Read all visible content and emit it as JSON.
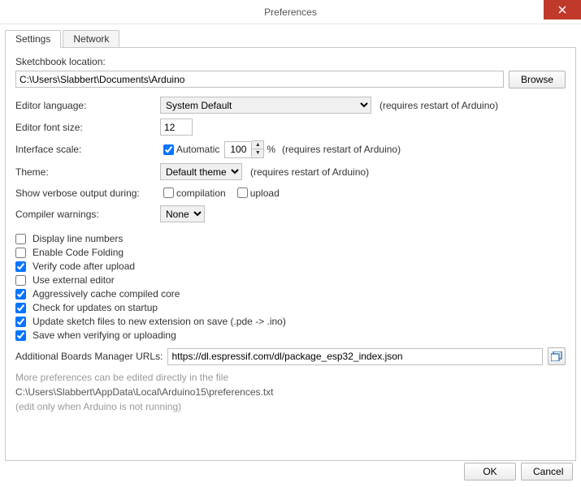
{
  "title": "Preferences",
  "tabs": {
    "settings": "Settings",
    "network": "Network"
  },
  "labels": {
    "sketchbook": "Sketchbook location:",
    "language": "Editor language:",
    "fontsize": "Editor font size:",
    "scale": "Interface scale:",
    "theme": "Theme:",
    "verbose": "Show verbose output during:",
    "warnings": "Compiler warnings:",
    "urls": "Additional Boards Manager URLs:"
  },
  "values": {
    "sketchbook_path": "C:\\Users\\Slabbert\\Documents\\Arduino",
    "language": "System Default",
    "fontsize": "12",
    "scale_auto": true,
    "scale_value": "100",
    "scale_pct": "%",
    "theme": "Default theme",
    "warnings": "None",
    "urls": "https://dl.espressif.com/dl/package_esp32_index.json"
  },
  "restart_note": "(requires restart of Arduino)",
  "verbose": {
    "compilation": "compilation",
    "upload": "upload"
  },
  "automatic_label": "Automatic",
  "checklist": {
    "line_numbers": "Display line numbers",
    "code_folding": "Enable Code Folding",
    "verify_upload": "Verify code after upload",
    "external_editor": "Use external editor",
    "cache_core": "Aggressively cache compiled core",
    "check_updates": "Check for updates on startup",
    "update_ext": "Update sketch files to new extension on save (.pde -> .ino)",
    "save_verify": "Save when verifying or uploading"
  },
  "checked": {
    "line_numbers": false,
    "code_folding": false,
    "verify_upload": true,
    "external_editor": false,
    "cache_core": true,
    "check_updates": true,
    "update_ext": true,
    "save_verify": true,
    "compilation": false,
    "upload": false
  },
  "buttons": {
    "browse": "Browse",
    "ok": "OK",
    "cancel": "Cancel"
  },
  "footer_notes": {
    "more": "More preferences can be edited directly in the file",
    "pref_path": "C:\\Users\\Slabbert\\AppData\\Local\\Arduino15\\preferences.txt",
    "edit_only": "(edit only when Arduino is not running)"
  }
}
